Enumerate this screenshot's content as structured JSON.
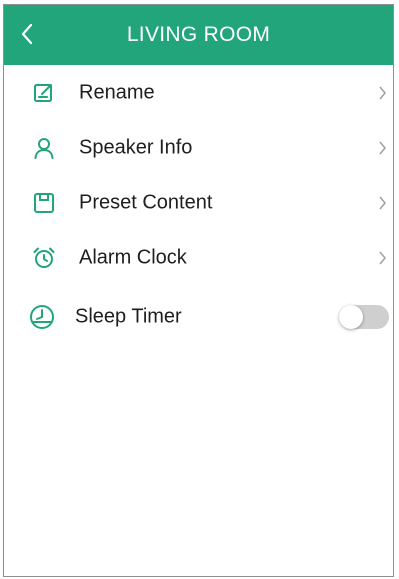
{
  "header": {
    "title": "LIVING ROOM",
    "back_icon": "chevron-left-icon",
    "bg_color": "#23a57b"
  },
  "menu": {
    "items": [
      {
        "label": "Rename",
        "icon": "edit-icon"
      },
      {
        "label": "Speaker Info",
        "icon": "person-icon"
      },
      {
        "label": "Preset Content",
        "icon": "preset-icon"
      },
      {
        "label": "Alarm Clock",
        "icon": "alarm-clock-icon"
      }
    ],
    "sleep_timer": {
      "label": "Sleep Timer",
      "icon": "clock-icon",
      "enabled": false
    }
  },
  "colors": {
    "accent": "#23a57b",
    "toggle_off": "#cfcfcf",
    "chevron": "#a0a0a0"
  }
}
